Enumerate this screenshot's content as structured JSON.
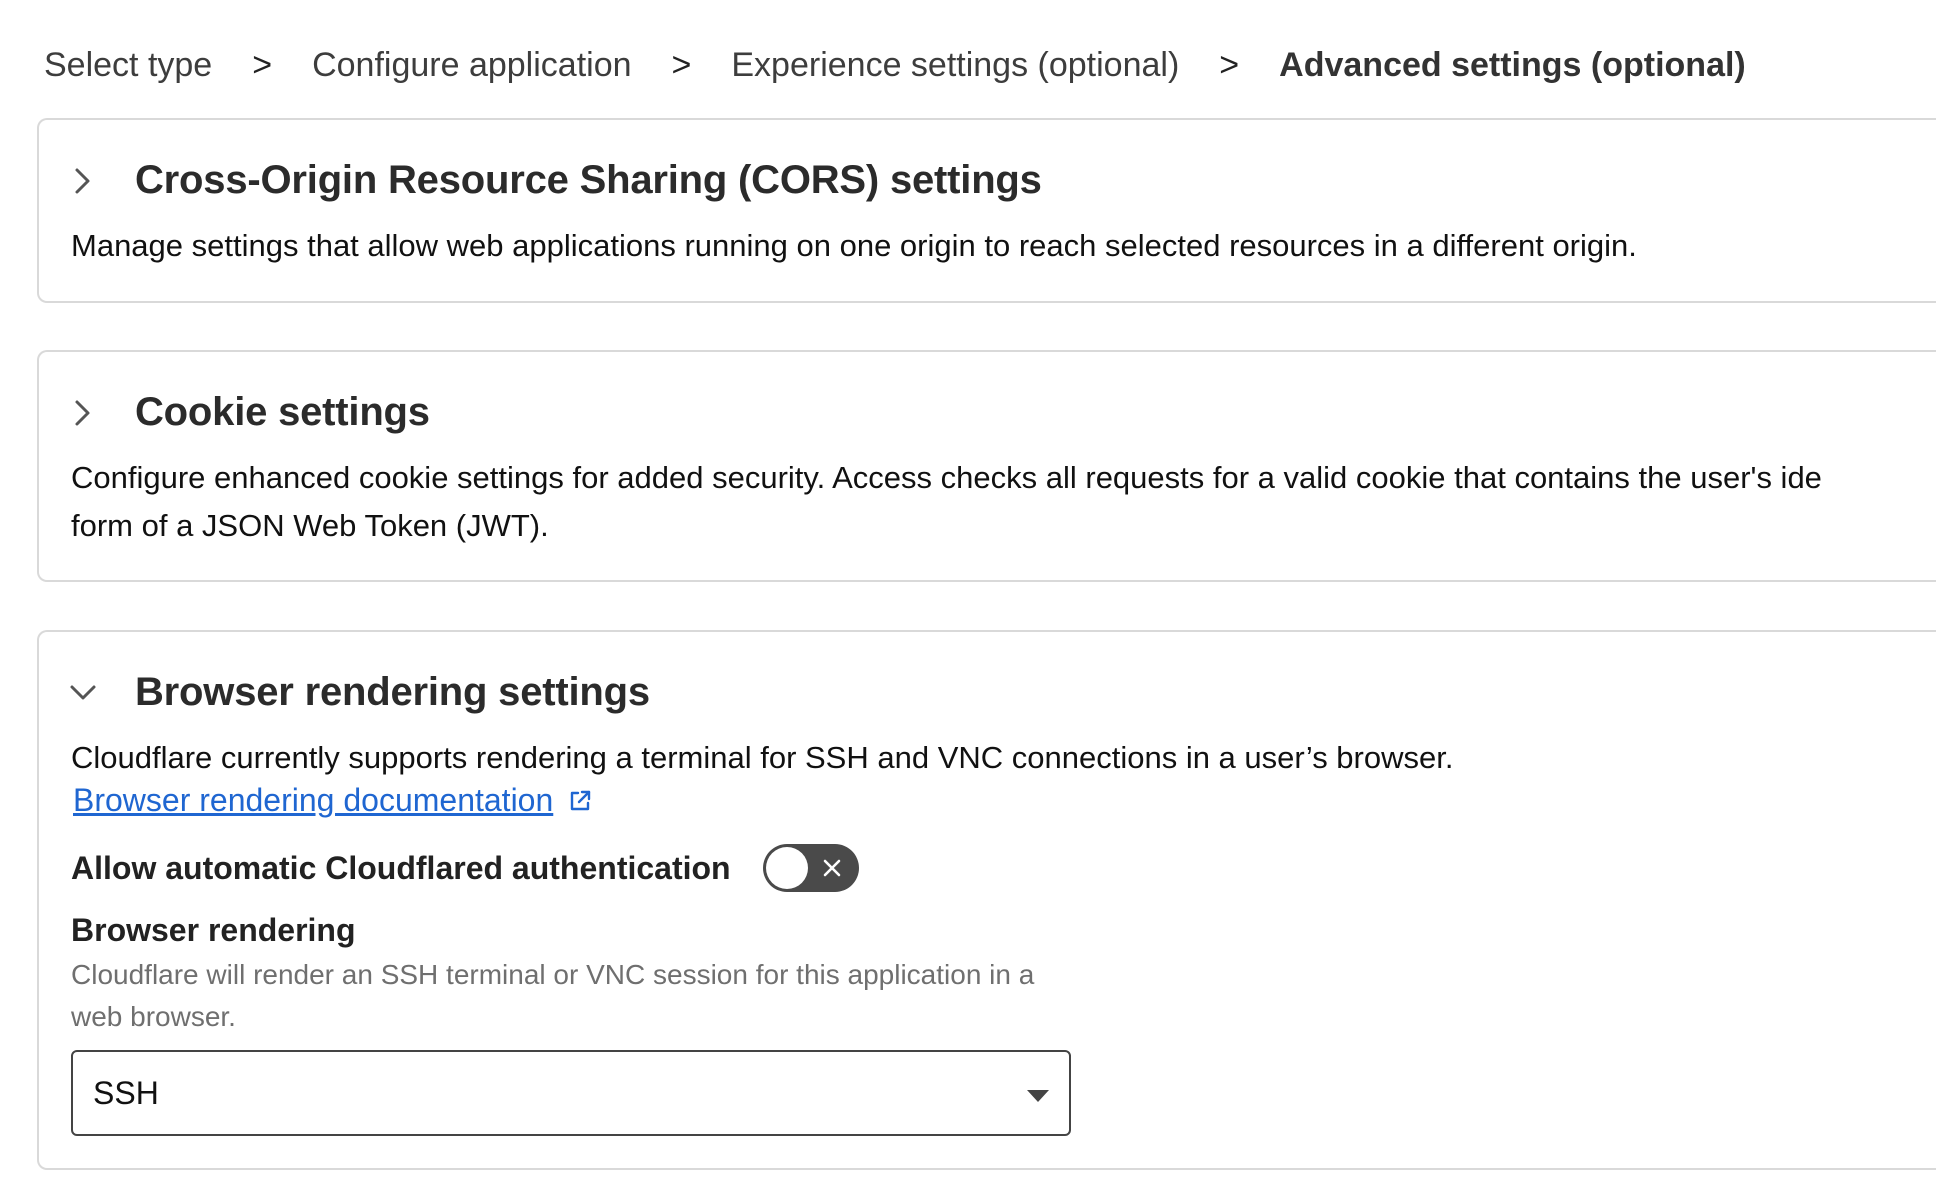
{
  "breadcrumb": {
    "items": [
      {
        "label": "Select type"
      },
      {
        "label": "Configure application"
      },
      {
        "label": "Experience settings (optional)"
      },
      {
        "label": "Advanced settings (optional)"
      }
    ],
    "separator": ">"
  },
  "sections": {
    "cors": {
      "title": "Cross-Origin Resource Sharing (CORS) settings",
      "description": "Manage settings that allow web applications running on one origin to reach selected resources in a different origin.",
      "expanded": false,
      "icon": "chevron-right-icon"
    },
    "cookie": {
      "title": "Cookie settings",
      "description_line1": "Configure enhanced cookie settings for added security. Access checks all requests for a valid cookie that contains the user's ide",
      "description_line2": "form of a JSON Web Token (JWT).",
      "expanded": false,
      "icon": "chevron-right-icon"
    },
    "browser_rendering": {
      "title": "Browser rendering settings",
      "description": "Cloudflare currently supports rendering a terminal for SSH and VNC connections in a user’s browser.",
      "expanded": true,
      "icon": "chevron-down-icon",
      "doc_link": {
        "label": "Browser rendering documentation",
        "icon": "external-link-icon"
      },
      "auto_auth": {
        "label": "Allow automatic Cloudflared authentication",
        "enabled": false
      },
      "rendering_field": {
        "label": "Browser rendering",
        "help": "Cloudflare will render an SSH terminal or VNC session for this application in a web browser.",
        "value": "SSH"
      }
    }
  },
  "colors": {
    "link": "#1f66d1",
    "toggle_off": "#4a4a4a",
    "border": "#d9d9d9"
  }
}
